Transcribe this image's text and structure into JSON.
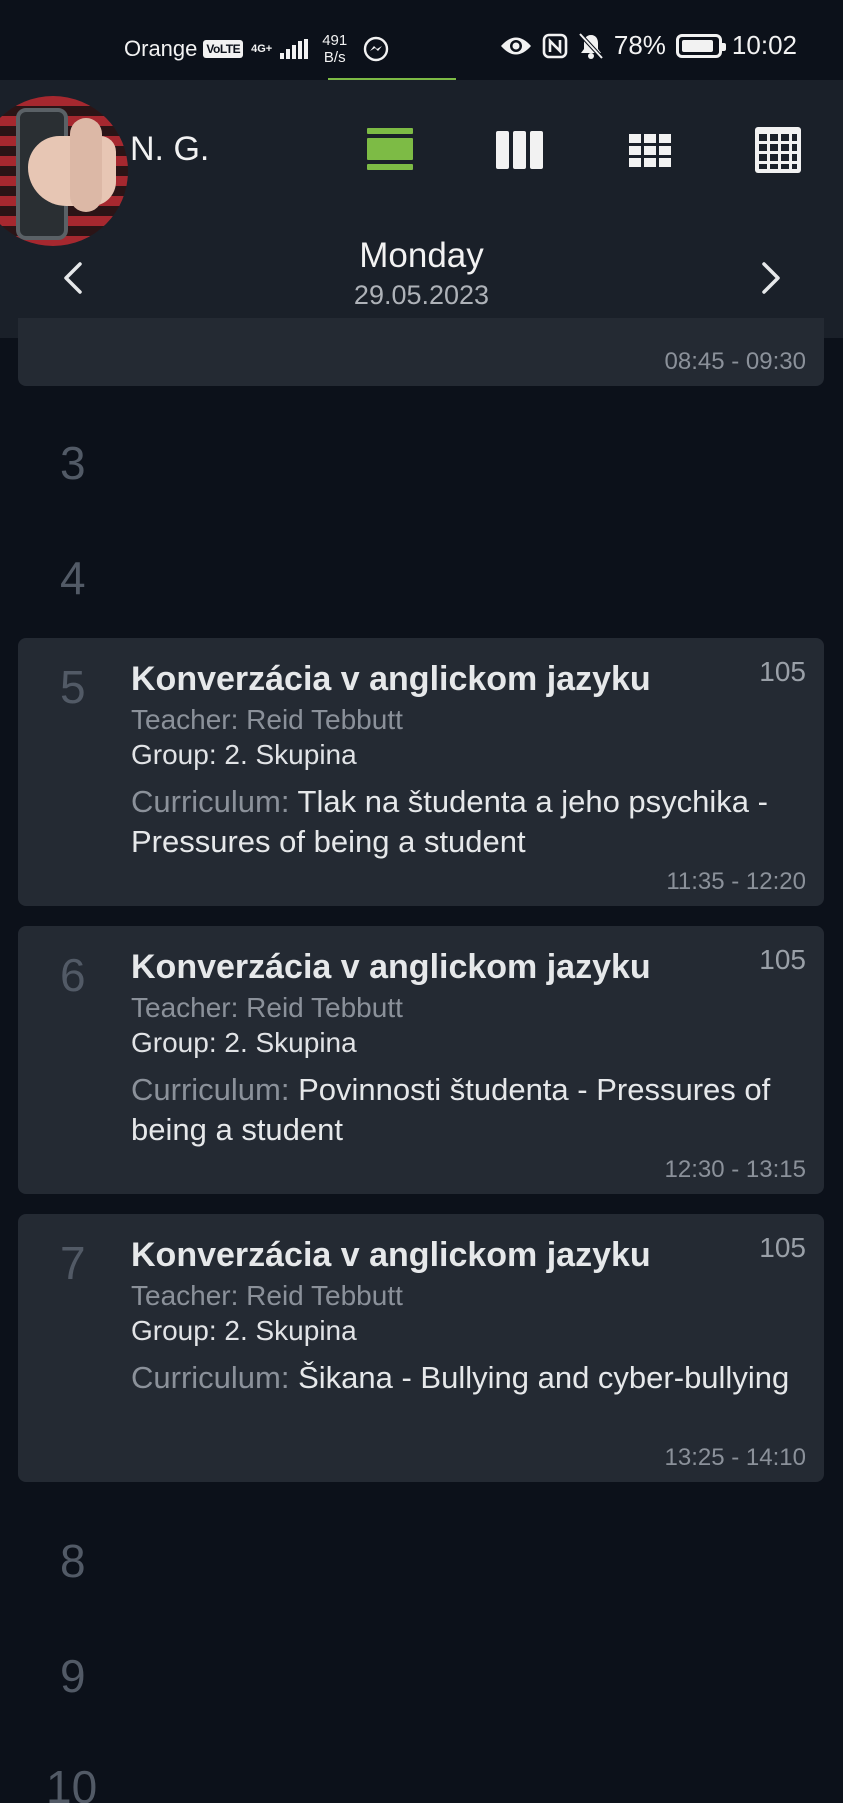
{
  "status_bar": {
    "carrier": "Orange",
    "volte": "VoLTE",
    "network": "4G+",
    "speed_value": "491",
    "speed_unit": "B/s",
    "battery": "78%",
    "time": "10:02"
  },
  "header": {
    "user_name": "N. G.",
    "view_modes": [
      "day-view",
      "3-day-view",
      "week-view",
      "month-view"
    ],
    "active_view": "day-view",
    "day_name": "Monday",
    "date": "29.05.2023",
    "accent_color": "#7dbb45"
  },
  "partial_lesson": {
    "time": "08:45 - 09:30"
  },
  "empty_slots": {
    "s3": "3",
    "s4": "4",
    "s8": "8",
    "s9": "9",
    "s10": "10"
  },
  "lessons": [
    {
      "number": "5",
      "title": "Konverzácia v anglickom jazyku",
      "room": "105",
      "teacher": "Teacher: Reid Tebbutt",
      "group": "Group: 2. Skupina",
      "curriculum_label": "Curriculum:",
      "curriculum_text": "Tlak na študenta a jeho psychika - Pressures of being a student",
      "time": "11:35 - 12:20"
    },
    {
      "number": "6",
      "title": "Konverzácia v anglickom jazyku",
      "room": "105",
      "teacher": "Teacher: Reid Tebbutt",
      "group": "Group: 2. Skupina",
      "curriculum_label": "Curriculum:",
      "curriculum_text": "Povinnosti študenta - Pressures of being a student",
      "time": "12:30 - 13:15"
    },
    {
      "number": "7",
      "title": "Konverzácia v anglickom jazyku",
      "room": "105",
      "teacher": "Teacher: Reid Tebbutt",
      "group": "Group: 2. Skupina",
      "curriculum_label": "Curriculum:",
      "curriculum_text": "Šikana - Bullying and cyber-bullying",
      "time": "13:25 - 14:10"
    }
  ]
}
